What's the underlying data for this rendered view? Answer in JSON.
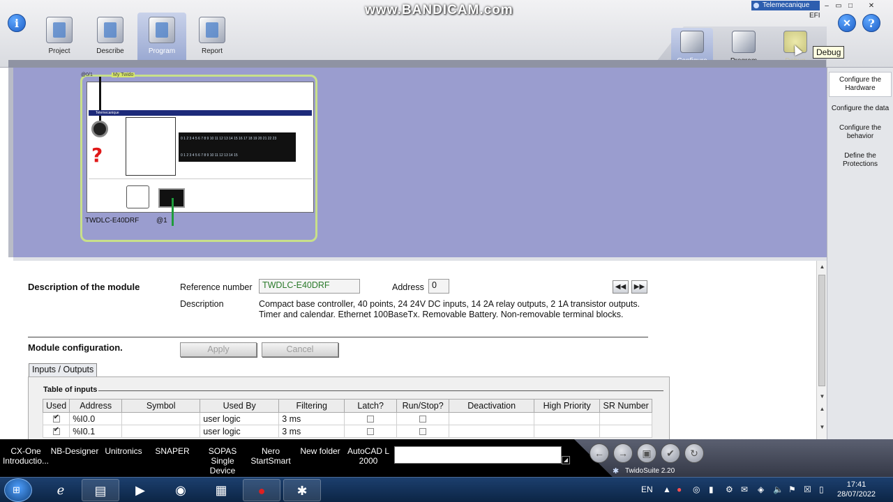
{
  "watermark": "www.BANDICAM.com",
  "brand_badge": "Telemecanique",
  "efi_label": "EFI",
  "toolbar": {
    "tools": [
      {
        "label": "Project"
      },
      {
        "label": "Describe"
      },
      {
        "label": "Program"
      },
      {
        "label": "Report"
      }
    ]
  },
  "modes": [
    {
      "label": "Configure"
    },
    {
      "label": "Program"
    },
    {
      "label": "Debug"
    }
  ],
  "tooltip": "Debug",
  "side_panel": [
    {
      "label": "Configure the Hardware"
    },
    {
      "label": "Configure the data"
    },
    {
      "label": "Configure the behavior"
    },
    {
      "label": "Define the Protections"
    }
  ],
  "plc": {
    "reference": "TWDLC-E40DRF",
    "address_tag": "@1",
    "top_tag": "My Twido",
    "brand": "Telemecanique"
  },
  "module": {
    "desc_title": "Description of the module",
    "ref_label": "Reference number",
    "ref_value": "TWDLC-E40DRF",
    "address_label": "Address",
    "address_value": "0",
    "description_label": "Description",
    "description_line1": "Compact base controller, 40 points, 24 24V DC inputs, 14 2A relay outputs, 2 1A transistor outputs.",
    "description_line2": "Timer and calendar. Ethernet 100BaseTx. Removable Battery. Non-removable terminal blocks.",
    "config_title": "Module configuration.",
    "apply_label": "Apply",
    "cancel_label": "Cancel",
    "tab_label": "Inputs / Outputs",
    "table_title": "Table of inputs"
  },
  "inputs_table": {
    "headers": [
      "Used",
      "Address",
      "Symbol",
      "Used By",
      "Filtering",
      "Latch?",
      "Run/Stop?",
      "Deactivation",
      "High Priority",
      "SR Number"
    ],
    "rows": [
      {
        "used": true,
        "address": "%I0.0",
        "symbol": "",
        "used_by": "user logic",
        "filtering": "3 ms",
        "latch": false,
        "run_stop": false,
        "deactivation": "",
        "high_priority": "",
        "sr_number": ""
      },
      {
        "used": true,
        "address": "%I0.1",
        "symbol": "",
        "used_by": "user logic",
        "filtering": "3 ms",
        "latch": false,
        "run_stop": false,
        "deactivation": "",
        "high_priority": "",
        "sr_number": ""
      }
    ]
  },
  "desktop_items": [
    {
      "line1": "CX-One",
      "line2": "Introductio..."
    },
    {
      "line1": "NB-Designer",
      "line2": ""
    },
    {
      "line1": "Unitronics",
      "line2": ""
    },
    {
      "line1": "SNAPER",
      "line2": ""
    },
    {
      "line1": "SOPAS Single",
      "line2": "Device"
    },
    {
      "line1": "Nero",
      "line2": "StartSmart"
    },
    {
      "line1": "New folder",
      "line2": ""
    },
    {
      "line1": "AutoCAD L",
      "line2": "2000"
    }
  ],
  "status": {
    "app_version": "TwidoSuite 2.20"
  },
  "taskbar": {
    "language": "EN",
    "time": "17:41",
    "date": "28/07/2022"
  }
}
